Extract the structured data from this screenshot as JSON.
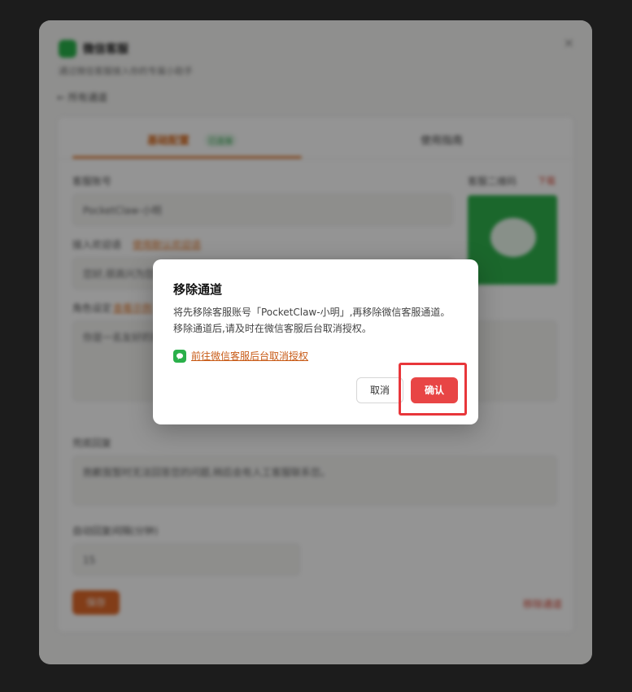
{
  "background_panel": {
    "title": "微信客服",
    "subtitle": "通过微信客服接入你的专属小助手",
    "close_glyph": "×",
    "back_label": "← 所有通道",
    "tabs": [
      {
        "label": "基础配置",
        "badge": "已连接"
      },
      {
        "label": "使用指南"
      }
    ],
    "fields": {
      "account_label": "客服账号",
      "account_value": "PocketClaw-小明",
      "welcome_label": "接入欢迎语",
      "welcome_link": "使用默认欢迎语",
      "welcome_value": "您好,很高兴为您服务",
      "persona_label": "角色设定",
      "persona_link": "查看示例",
      "persona_value": "你是一名友好的客服助手,请耐心回答用户的问题,保持礼貌和专业。",
      "fallback_label": "兜底回复",
      "fallback_value": "抱歉我暂时无法回答您的问题,稍后会有人工客服联系您。",
      "limit_label": "自动回复间隔(分钟)",
      "limit_value": "15"
    },
    "qr": {
      "label": "客服二维码",
      "link": "下载"
    },
    "save_label": "保存",
    "delete_label": "移除通道"
  },
  "modal": {
    "title": "移除通道",
    "body_line1": "将先移除客服账号「PocketClaw-小明」,再移除微信客服通道。",
    "body_line2": "移除通道后,请及时在微信客服后台取消授权。",
    "link_label": "前往微信客服后台取消授权",
    "cancel_label": "取消",
    "confirm_label": "确认"
  },
  "colors": {
    "accent": "#e07a2f",
    "danger": "#e84545",
    "wechat_green": "#2ab04a",
    "highlight": "#e8363a"
  }
}
